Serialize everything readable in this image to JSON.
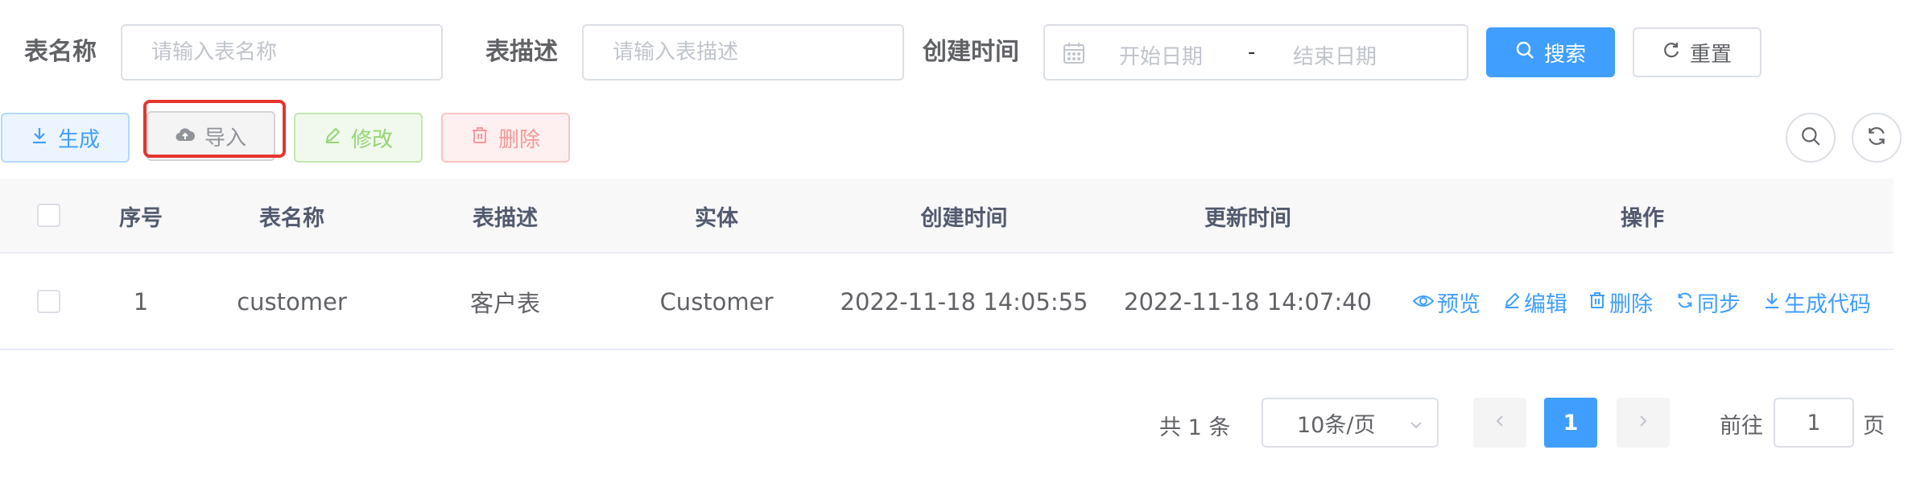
{
  "search": {
    "table_name_label": "表名称",
    "table_name_placeholder": "请输入表名称",
    "table_desc_label": "表描述",
    "table_desc_placeholder": "请输入表描述",
    "created_time_label": "创建时间",
    "start_date_placeholder": "开始日期",
    "date_separator": "-",
    "end_date_placeholder": "结束日期",
    "search_button": "搜索",
    "reset_button": "重置"
  },
  "toolbar": {
    "generate": "生成",
    "import": "导入",
    "edit": "修改",
    "delete": "删除"
  },
  "table": {
    "columns": [
      "序号",
      "表名称",
      "表描述",
      "实体",
      "创建时间",
      "更新时间",
      "操作"
    ],
    "rows": [
      {
        "index": "1",
        "table_name": "customer",
        "table_desc": "客户表",
        "entity": "Customer",
        "created": "2022-11-18 14:05:55",
        "updated": "2022-11-18 14:07:40",
        "actions": [
          "预览",
          "编辑",
          "删除",
          "同步",
          "生成代码"
        ]
      }
    ]
  },
  "pagination": {
    "total_text": "共 1 条",
    "page_size": "10条/页",
    "current_page": "1",
    "goto_label": "前往",
    "goto_value": "1",
    "page_suffix": "页"
  },
  "colors": {
    "primary": "#409eff",
    "success": "#67c23a",
    "danger": "#f56c6c",
    "highlight_box": "#e5352d"
  }
}
